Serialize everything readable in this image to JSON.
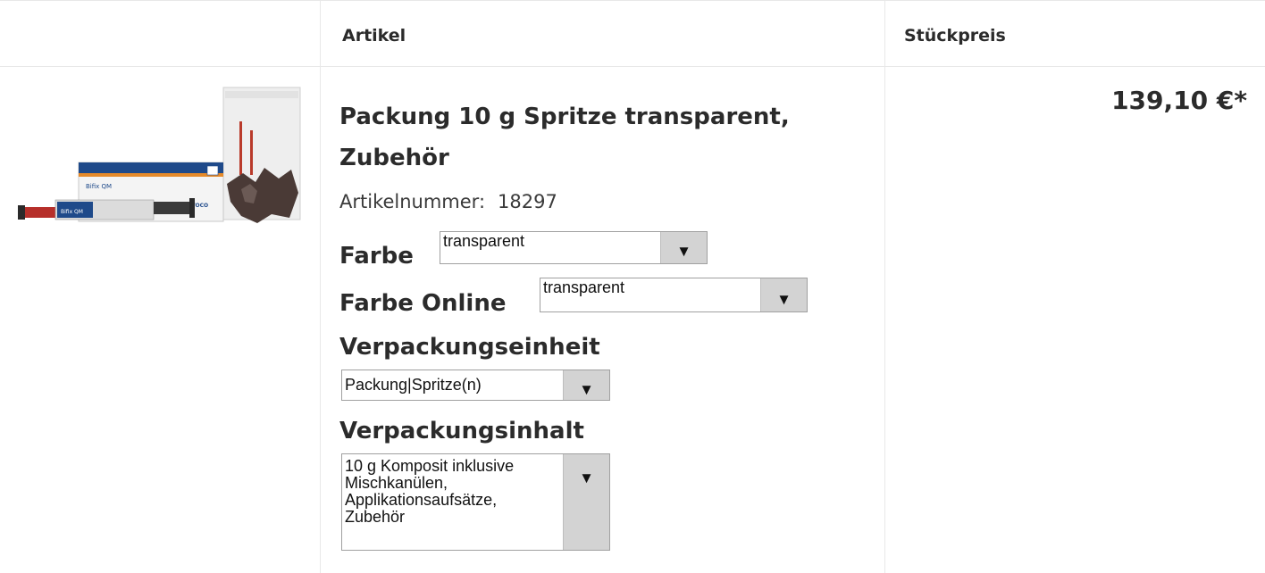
{
  "table": {
    "headers": {
      "article": "Artikel",
      "unit_price": "Stückpreis"
    }
  },
  "product": {
    "image_alt": "Bifix QM",
    "title": "Packung 10 g Spritze transparent, Zubehör",
    "article_number_label": "Artikelnummer:",
    "article_number": "18297",
    "price": "139,10 €*"
  },
  "options": {
    "farbe": {
      "label": "Farbe",
      "value": "transparent"
    },
    "farbe_online": {
      "label": "Farbe Online",
      "value": "transparent"
    },
    "verpackungseinheit": {
      "label": "Verpackungseinheit",
      "value": "Packung|Spritze(n)"
    },
    "verpackungsinhalt": {
      "label": "Verpackungsinhalt",
      "value": "10 g Komposit inklusive Mischkanülen, Applikationsaufsätze, Zubehör"
    }
  },
  "icons": {
    "dropdown": "triangle-down-icon"
  },
  "colors": {
    "grid": "#e8e8e8",
    "select_button": "#d3d3d3",
    "text": "#2b2b2b"
  }
}
